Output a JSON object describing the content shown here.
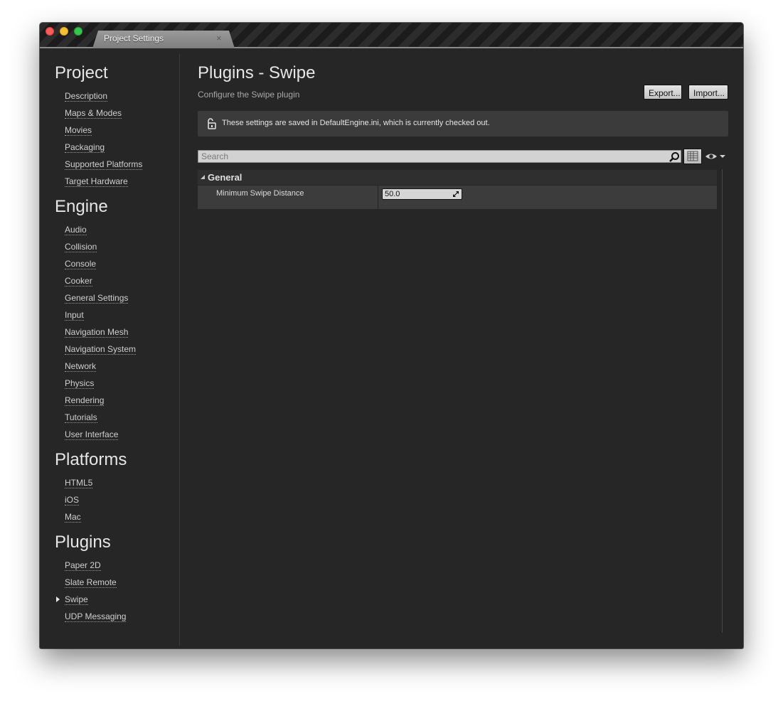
{
  "window": {
    "tab_title": "Project Settings",
    "tab_close": "×"
  },
  "sidebar": {
    "sections": [
      {
        "title": "Project",
        "items": [
          "Description",
          "Maps & Modes",
          "Movies",
          "Packaging",
          "Supported Platforms",
          "Target Hardware"
        ]
      },
      {
        "title": "Engine",
        "items": [
          "Audio",
          "Collision",
          "Console",
          "Cooker",
          "General Settings",
          "Input",
          "Navigation Mesh",
          "Navigation System",
          "Network",
          "Physics",
          "Rendering",
          "Tutorials",
          "User Interface"
        ]
      },
      {
        "title": "Platforms",
        "items": [
          "HTML5",
          "iOS",
          "Mac"
        ]
      },
      {
        "title": "Plugins",
        "items": [
          "Paper 2D",
          "Slate Remote",
          "Swipe",
          "UDP Messaging"
        ]
      }
    ],
    "selected_item": "Swipe"
  },
  "main": {
    "title": "Plugins - Swipe",
    "subtitle": "Configure the Swipe plugin",
    "export_label": "Export...",
    "import_label": "Import...",
    "notice": "These settings are saved in DefaultEngine.ini, which is currently checked out.",
    "search_placeholder": "Search",
    "category": "General",
    "property": {
      "name": "Minimum Swipe Distance",
      "value": "50.0"
    }
  },
  "colors": {
    "window_bg": "#262626",
    "panel_bg": "#3b3b3b",
    "text": "#e6e6e6",
    "close": "#fc5b57",
    "minimize": "#fdbd2e",
    "maximize": "#34c84a"
  }
}
